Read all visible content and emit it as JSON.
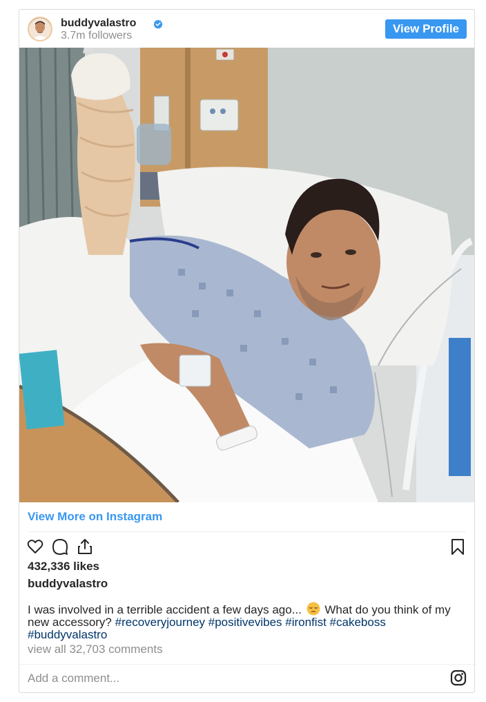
{
  "header": {
    "username": "buddyvalastro",
    "followers": "3.7m followers",
    "view_profile_label": "View Profile"
  },
  "colors": {
    "accent": "#3897f0",
    "hashtag": "#003569",
    "muted": "#8e8e8e"
  },
  "view_more_label": "View More on Instagram",
  "actions": {
    "icons": [
      "heart-icon",
      "comment-icon",
      "share-icon",
      "bookmark-icon"
    ]
  },
  "likes": "432,336 likes",
  "poster": "buddyvalastro",
  "caption": {
    "text_before": "I was involved in a terrible accident a few days ago...",
    "emoji_name": "pensive-face-emoji",
    "text_after": "What do you think of my new accessory?",
    "hashtags": [
      "#recoveryjourney",
      "#positivevibes",
      "#ironfist",
      "#cakeboss",
      "#buddyvalastro"
    ]
  },
  "view_comments": "view all 32,703 comments",
  "add_comment_placeholder": "Add a comment..."
}
